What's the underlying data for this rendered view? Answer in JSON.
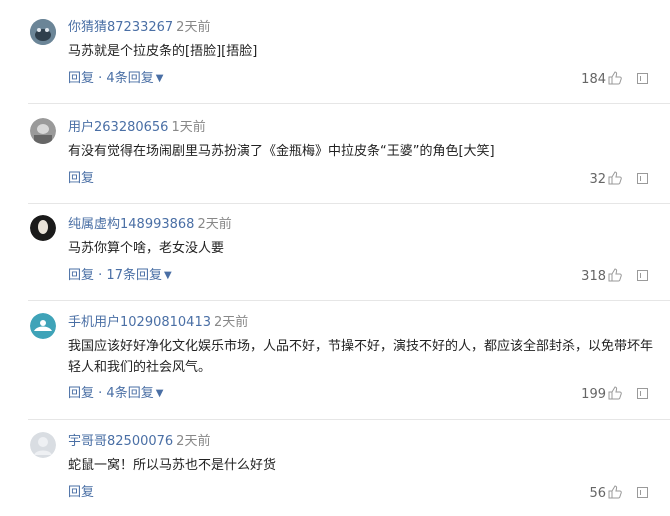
{
  "comments": [
    {
      "username": "你猜猜87233267",
      "time": "2天前",
      "content": "马苏就是个拉皮条的[捂脸][捂脸]",
      "reply": "回复",
      "reply_sep": " · ",
      "reply_count": "4条回复",
      "likes": "184"
    },
    {
      "username": "用户263280656",
      "time": "1天前",
      "content": "有没有觉得在场闹剧里马苏扮演了《金瓶梅》中拉皮条“王婆”的角色[大笑]",
      "reply": "回复",
      "reply_sep": "",
      "reply_count": "",
      "likes": "32"
    },
    {
      "username": "纯属虚构148993868",
      "time": "2天前",
      "content": "马苏你算个啥，老女没人要",
      "reply": "回复",
      "reply_sep": " · ",
      "reply_count": "17条回复",
      "likes": "318"
    },
    {
      "username": "手机用户10290810413",
      "time": "2天前",
      "content": "我国应该好好净化文化娱乐市场，人品不好，节操不好，演技不好的人，都应该全部封杀，以免带坏年轻人和我们的社会风气。",
      "reply": "回复",
      "reply_sep": " · ",
      "reply_count": "4条回复",
      "likes": "199"
    },
    {
      "username": "宇哥哥82500076",
      "time": "2天前",
      "content": "蛇鼠一窝！所以马苏也不是什么好货",
      "reply": "回复",
      "reply_sep": "",
      "reply_count": "",
      "likes": "56"
    }
  ],
  "icons": {
    "thumb": "thumbs-up-icon",
    "box": "report-icon",
    "chevron": "chevron-down-icon"
  },
  "colors": {
    "username": "#4a6fa5",
    "time": "#888888",
    "text": "#222222",
    "divider": "#e6e6e6"
  }
}
